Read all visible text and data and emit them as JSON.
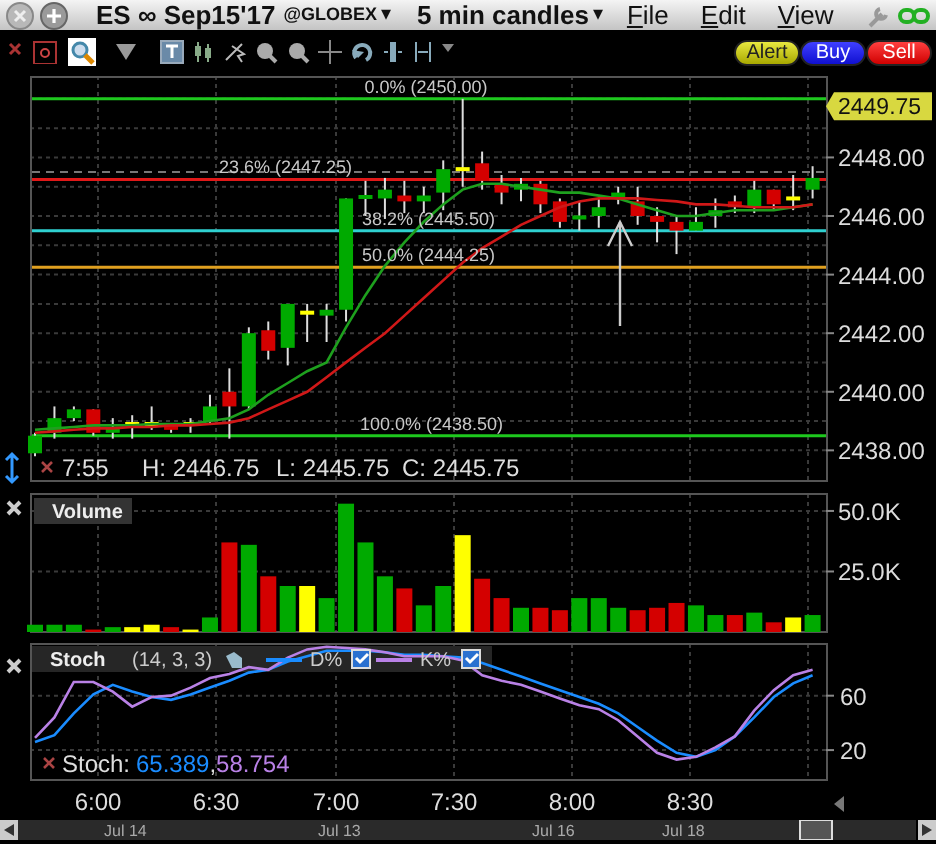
{
  "title_bar": {
    "symbol": "ES ∞ Sep15'17",
    "exchange": "@GLOBEX",
    "exchange_caret": "▾",
    "timeframe": "5 min candles",
    "timeframe_caret": "▾",
    "menu": [
      "File",
      "Edit",
      "View"
    ]
  },
  "toolbar": {
    "buttons": [
      {
        "label": "Alert",
        "kind": "alert"
      },
      {
        "label": "Buy",
        "kind": "buy"
      },
      {
        "label": "Sell",
        "kind": "sell"
      }
    ]
  },
  "price_panel": {
    "last_price": "2449.75",
    "chart_data": {
      "type": "candlestick",
      "grid": true,
      "ylim": [
        2436.92,
        2450.78
      ],
      "yticks": [
        {
          "value": 2438,
          "label": "2438.00"
        },
        {
          "value": 2440,
          "label": "2440.00"
        },
        {
          "value": 2442,
          "label": "2442.00"
        },
        {
          "value": 2444,
          "label": "2444.00"
        },
        {
          "value": 2446,
          "label": "2446.00"
        },
        {
          "value": 2448,
          "label": "2448.00"
        }
      ],
      "ohlc": [
        [
          2437.9,
          2438.6,
          2437.8,
          2438.5
        ],
        [
          2438.6,
          2439.5,
          2438.4,
          2439.1
        ],
        [
          2439.1,
          2439.5,
          2439.0,
          2439.4
        ],
        [
          2439.4,
          2439.4,
          2438.5,
          2438.6
        ],
        [
          2438.6,
          2439.1,
          2438.4,
          2438.75
        ],
        [
          2438.9,
          2439.2,
          2438.4,
          2438.9
        ],
        [
          2438.9,
          2439.5,
          2438.7,
          2438.9
        ],
        [
          2438.9,
          2438.9,
          2438.6,
          2438.7
        ],
        [
          2438.9,
          2439.1,
          2438.6,
          2438.9
        ],
        [
          2439.0,
          2439.9,
          2438.9,
          2439.5
        ],
        [
          2440.0,
          2440.8,
          2438.4,
          2439.5
        ],
        [
          2439.5,
          2442.2,
          2439.4,
          2442.0
        ],
        [
          2442.1,
          2442.4,
          2441.1,
          2441.4
        ],
        [
          2441.5,
          2443.0,
          2440.9,
          2443.0
        ],
        [
          2442.7,
          2443.0,
          2441.7,
          2442.7
        ],
        [
          2442.6,
          2443.0,
          2441.7,
          2442.8
        ],
        [
          2442.8,
          2446.6,
          2442.4,
          2446.6
        ],
        [
          2446.6,
          2447.2,
          2446.0,
          2446.7
        ],
        [
          2446.6,
          2447.3,
          2445.9,
          2446.9
        ],
        [
          2446.7,
          2447.2,
          2446.1,
          2446.5
        ],
        [
          2446.5,
          2447.0,
          2446.1,
          2446.7
        ],
        [
          2446.8,
          2447.9,
          2446.2,
          2447.6
        ],
        [
          2447.6,
          2450.0,
          2447.0,
          2447.6
        ],
        [
          2447.8,
          2448.2,
          2446.9,
          2447.2
        ],
        [
          2447.1,
          2447.4,
          2446.4,
          2446.8
        ],
        [
          2446.9,
          2447.3,
          2446.5,
          2447.1
        ],
        [
          2447.1,
          2447.2,
          2446.1,
          2446.4
        ],
        [
          2446.5,
          2446.6,
          2445.6,
          2445.8
        ],
        [
          2445.9,
          2446.5,
          2445.5,
          2446.0
        ],
        [
          2446.0,
          2446.6,
          2445.6,
          2446.3
        ],
        [
          2446.6,
          2447.0,
          2446.4,
          2446.8
        ],
        [
          2446.5,
          2447.0,
          2445.7,
          2446.0
        ],
        [
          2446.0,
          2446.3,
          2445.1,
          2445.8
        ],
        [
          2445.8,
          2446.0,
          2444.7,
          2445.5
        ],
        [
          2445.5,
          2446.3,
          2445.5,
          2445.8
        ],
        [
          2446.0,
          2446.6,
          2445.6,
          2446.2
        ],
        [
          2446.5,
          2446.7,
          2446.1,
          2446.3
        ],
        [
          2446.3,
          2447.2,
          2446.1,
          2446.9
        ],
        [
          2446.9,
          2446.9,
          2446.2,
          2446.4
        ],
        [
          2446.6,
          2447.4,
          2446.2,
          2446.6
        ],
        [
          2446.9,
          2447.7,
          2446.6,
          2447.3
        ]
      ],
      "series": [
        {
          "type": "line",
          "color": "#1ea01e",
          "values": [
            2438.7,
            2438.75,
            2438.8,
            2438.85,
            2438.85,
            2438.85,
            2438.9,
            2438.9,
            2438.9,
            2439.0,
            2439.1,
            2439.4,
            2439.9,
            2440.3,
            2440.7,
            2441.0,
            2442.2,
            2443.3,
            2444.3,
            2445.1,
            2445.8,
            2446.4,
            2446.9,
            2447.1,
            2447.1,
            2447.0,
            2446.9,
            2446.8,
            2446.8,
            2446.7,
            2446.6,
            2446.4,
            2446.2,
            2446.0,
            2446.0,
            2446.1,
            2446.2,
            2446.2,
            2446.2,
            2446.3,
            2446.4
          ]
        },
        {
          "type": "line",
          "color": "#d01818",
          "values": [
            2438.6,
            2438.65,
            2438.7,
            2438.75,
            2438.75,
            2438.8,
            2438.8,
            2438.85,
            2438.85,
            2438.9,
            2438.95,
            2439.1,
            2439.4,
            2439.7,
            2440.0,
            2440.5,
            2441.0,
            2441.5,
            2442.0,
            2442.6,
            2443.2,
            2443.8,
            2444.4,
            2444.9,
            2445.3,
            2445.7,
            2446.0,
            2446.3,
            2446.5,
            2446.6,
            2446.6,
            2446.6,
            2446.55,
            2446.5,
            2446.4,
            2446.4,
            2446.35,
            2446.3,
            2446.3,
            2446.3,
            2446.4
          ]
        }
      ],
      "ref_lines": [
        {
          "axis": "y",
          "value": 2450,
          "label": "0.0% (2450.00)",
          "color": "#1ec81e"
        },
        {
          "axis": "y",
          "value": 2447.25,
          "label": "23.6% (2447.25)",
          "color": "#e01818"
        },
        {
          "axis": "y",
          "value": 2445.5,
          "label": "38.2% (2445.50)",
          "color": "#2fd0d0"
        },
        {
          "axis": "y",
          "value": 2444.25,
          "label": "50.0% (2444.25)",
          "color": "#e0a020"
        },
        {
          "axis": "y",
          "value": 2438.5,
          "label": "100.0% (2438.50)",
          "color": "#1ec81e"
        },
        {
          "axis": "y",
          "value": 2447.5,
          "color": "#777777"
        }
      ]
    },
    "readout": {
      "time": "7:55",
      "values": [
        "H: 2446.75",
        "L: 2445.75",
        "C: 2445.75"
      ]
    }
  },
  "volume_panel": {
    "chart_data": {
      "type": "bar",
      "title": "Volume",
      "stacked": true,
      "grid": true,
      "ylim": [
        0,
        57000
      ],
      "yticks": [
        {
          "value": 25000,
          "label": "25.0K"
        },
        {
          "value": 50000,
          "label": "50.0K"
        }
      ],
      "series": [
        {
          "color": "#00aa00",
          "values": [
            3000,
            3000,
            3000,
            null,
            2000,
            null,
            null,
            null,
            null,
            6000,
            null,
            36000,
            null,
            19000,
            null,
            14000,
            53000,
            37000,
            23000,
            null,
            11000,
            19000,
            null,
            null,
            null,
            10000,
            null,
            null,
            14000,
            14000,
            10000,
            null,
            null,
            null,
            11000,
            7000,
            null,
            8000,
            null,
            null,
            7000
          ]
        },
        {
          "color": "#d40000",
          "values": [
            null,
            null,
            null,
            1000,
            null,
            null,
            null,
            2000,
            null,
            null,
            37000,
            null,
            23000,
            null,
            null,
            null,
            null,
            null,
            null,
            18000,
            null,
            null,
            null,
            22000,
            14000,
            null,
            10000,
            9000,
            null,
            null,
            null,
            9000,
            10000,
            12000,
            null,
            null,
            7000,
            null,
            4000,
            null,
            null
          ]
        },
        {
          "color": "#ffff00",
          "values": [
            null,
            null,
            null,
            null,
            null,
            2000,
            3000,
            null,
            1000,
            null,
            null,
            null,
            null,
            null,
            19000,
            null,
            null,
            null,
            null,
            null,
            null,
            null,
            40000,
            null,
            null,
            null,
            null,
            null,
            null,
            null,
            null,
            null,
            null,
            null,
            null,
            null,
            null,
            null,
            null,
            6000,
            null
          ]
        }
      ]
    }
  },
  "stoch_panel": {
    "params": "(14, 3, 3)",
    "chart_data": {
      "type": "line",
      "title": "Stoch",
      "grid": true,
      "ylim": [
        -2,
        98
      ],
      "yticks": [
        20,
        60
      ],
      "legend": {
        "items": [
          {
            "checked": true
          },
          {
            "checked": true
          }
        ]
      },
      "series": [
        {
          "name": "D%",
          "color": "#1a8cff",
          "values": [
            26,
            31,
            47,
            61,
            68,
            63,
            59,
            57,
            61,
            66,
            71,
            77,
            79,
            85,
            89,
            93,
            93,
            93,
            92,
            90,
            90,
            89,
            88,
            84,
            79,
            74,
            69,
            64,
            59,
            54,
            47,
            37,
            27,
            18,
            15,
            20,
            30,
            44,
            59,
            69,
            75
          ]
        },
        {
          "name": "K%",
          "color": "#b981e6",
          "values": [
            29,
            44,
            70,
            70,
            63,
            52,
            59,
            60,
            66,
            73,
            76,
            81,
            79,
            88,
            94,
            96,
            95,
            94,
            92,
            89,
            89,
            89,
            86,
            75,
            71,
            68,
            63,
            58,
            53,
            50,
            42,
            30,
            18,
            13,
            15,
            22,
            30,
            49,
            64,
            75,
            79
          ]
        }
      ]
    },
    "readout": {
      "label": "Stoch:",
      "d": "65.389",
      "separator": ",",
      "k": "58.754"
    }
  },
  "time_axis": {
    "labels": [
      "6:00",
      "6:30",
      "7:00",
      "7:30",
      "8:00",
      "8:30"
    ]
  },
  "scrollbar": {
    "dates": [
      "Jul 14",
      "Jul 13",
      "Jul 16",
      "Jul 18"
    ]
  }
}
